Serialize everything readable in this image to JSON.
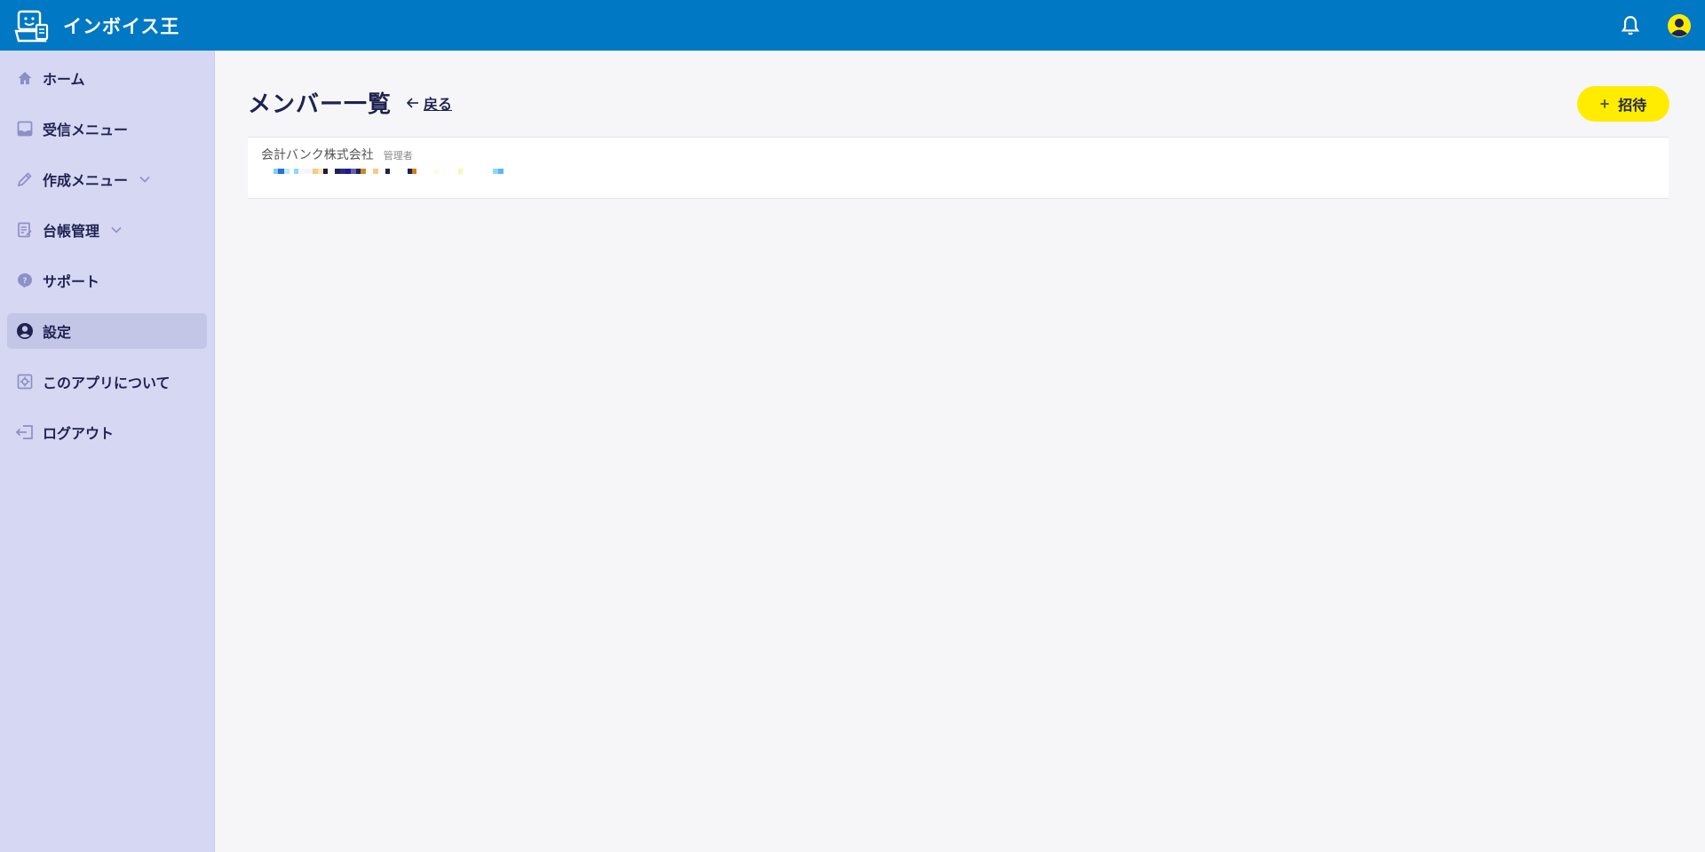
{
  "app": {
    "name": "インボイス王",
    "brand_color": "#0078c3",
    "accent_color": "#ffec00",
    "sidebar_color": "#d5d7f3",
    "text_color": "#1f2251"
  },
  "header": {
    "notification_icon": "bell-icon",
    "account_icon": "user-avatar-icon"
  },
  "sidebar": {
    "items": [
      {
        "label": "ホーム",
        "icon": "home-icon",
        "active": false,
        "expandable": false
      },
      {
        "label": "受信メニュー",
        "icon": "inbox-icon",
        "active": false,
        "expandable": false
      },
      {
        "label": "作成メニュー",
        "icon": "pencil-icon",
        "active": false,
        "expandable": true
      },
      {
        "label": "台帳管理",
        "icon": "ledger-icon",
        "active": false,
        "expandable": true
      },
      {
        "label": "サポート",
        "icon": "help-icon",
        "active": false,
        "expandable": false
      },
      {
        "label": "設定",
        "icon": "account-circle-icon",
        "active": true,
        "expandable": false
      },
      {
        "label": "このアプリについて",
        "icon": "app-info-icon",
        "active": false,
        "expandable": false
      },
      {
        "label": "ログアウト",
        "icon": "logout-icon",
        "active": false,
        "expandable": false
      }
    ]
  },
  "page": {
    "title": "メンバー一覧",
    "back_label": "戻る",
    "invite_label": "招待",
    "invite_icon": "plus-icon"
  },
  "members": [
    {
      "company": "会計バンク株式会社",
      "role": "管理者"
    }
  ]
}
